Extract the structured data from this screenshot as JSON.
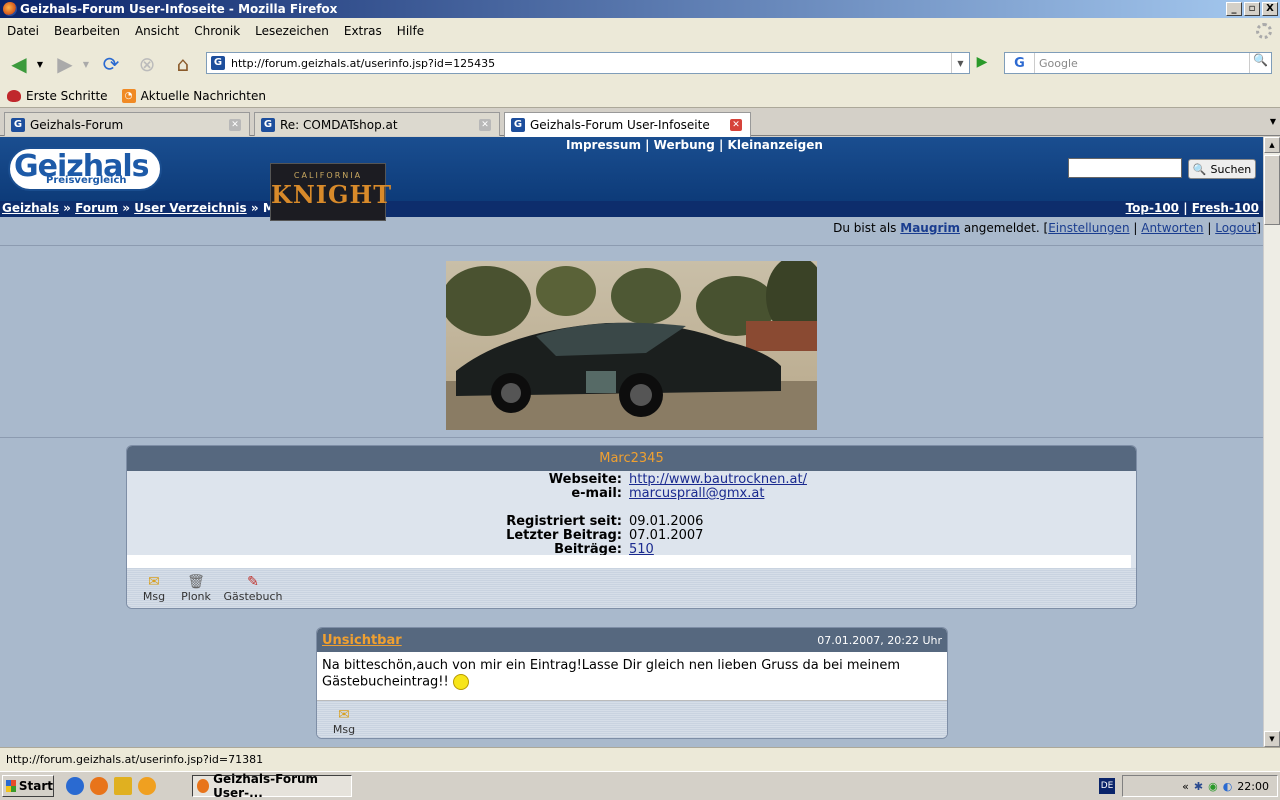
{
  "window": {
    "title": "Geizhals-Forum User-Infoseite - Mozilla Firefox",
    "controls": [
      "_",
      "▫",
      "X"
    ]
  },
  "menu": [
    "Datei",
    "Bearbeiten",
    "Ansicht",
    "Chronik",
    "Lesezeichen",
    "Extras",
    "Hilfe"
  ],
  "nav": {
    "url": "http://forum.geizhals.at/userinfo.jsp?id=125435",
    "search_placeholder": "Google",
    "search_engine": "G"
  },
  "bookmarks": [
    "Erste Schritte",
    "Aktuelle Nachrichten"
  ],
  "tabs": [
    {
      "label": "Geizhals-Forum",
      "active": false
    },
    {
      "label": "Re: COMDATshop.at",
      "active": false
    },
    {
      "label": "Geizhals-Forum User-Infoseite",
      "active": true
    }
  ],
  "site": {
    "logo_main": "Geizhals",
    "logo_sub": "Preisvergleich",
    "topnav": "Impressum | Werbung | Kleinanzeigen",
    "search_button": "Suchen",
    "ad": {
      "line1": "CALIFORNIA",
      "line2": "KNIGHT"
    },
    "crumbs": [
      "Geizhals",
      "Forum",
      "User Verzeichnis",
      "M"
    ],
    "crumb_sep": "»",
    "right_links": [
      "Top-100",
      "Fresh-100"
    ],
    "login": {
      "prefix": "Du bist als",
      "user": "Maugrim",
      "suffix": "angemeldet. [",
      "links": [
        "Einstellungen",
        "Antworten",
        "Logout"
      ],
      "end": "]"
    }
  },
  "profile": {
    "name": "Marc2345",
    "rows": [
      {
        "key": "Webseite:",
        "value": "http://www.bautrocknen.at/",
        "link": true
      },
      {
        "key": "e-mail:",
        "value": "marcusprall@gmx.at",
        "link": true
      },
      {
        "key": "",
        "value": "",
        "link": false
      },
      {
        "key": "Registriert seit:",
        "value": "09.01.2006",
        "link": false
      },
      {
        "key": "Letzter Beitrag:",
        "value": "07.01.2007",
        "link": false
      },
      {
        "key": "Beiträge:",
        "value": "510",
        "link": true
      }
    ],
    "actions": [
      {
        "label": "Msg",
        "icon": "message-icon"
      },
      {
        "label": "Plonk",
        "icon": "trash-icon"
      },
      {
        "label": "Gästebuch",
        "icon": "guestbook-icon"
      }
    ]
  },
  "guestbook": {
    "author": "Unsichtbar",
    "date": "07.01.2007, 20:22 Uhr",
    "text_line1": "Na bitteschön,auch von mir ein Eintrag!Lasse Dir gleich nen lieben Gruss da bei meinem",
    "text_line2": "Gästebucheintrag!!",
    "action": "Msg"
  },
  "status": "http://forum.geizhals.at/userinfo.jsp?id=71381",
  "taskbar": {
    "start": "Start",
    "item": "Geizhals-Forum User-...",
    "clock": "22:00",
    "lang": "DE",
    "chevron": "«"
  }
}
